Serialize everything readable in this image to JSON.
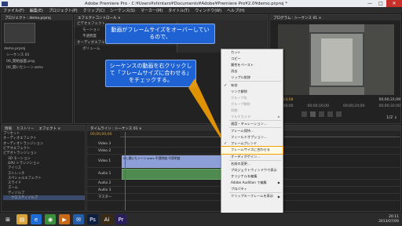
{
  "window": {
    "title": "Adobe Premiere Pro - C:¥Users¥shintaro¥Documents¥Adobe¥Premiere Pro¥2.0¥demo.prproj *",
    "min": "—",
    "max": "□",
    "close": "✕"
  },
  "menu": [
    "ファイル(F)",
    "編集(E)",
    "プロジェクト(P)",
    "クリップ(C)",
    "シーケンス(S)",
    "マーカー(M)",
    "タイトル(T)",
    "ウィンドウ(W)",
    "ヘルプ(H)"
  ],
  "project_panel": {
    "tab": "プロジェクト : demo.prproj",
    "file": "demo.prproj",
    "items": [
      "シーケンス 01",
      "00_開始画面.png",
      "00_開いたシーン.wmv"
    ]
  },
  "effect_controls": {
    "tab": "エフェクトコントロール ×",
    "rows": [
      "ビデオエフェクト",
      "モーション",
      "不透明度",
      "オーディオエフェクト",
      "ボリューム"
    ]
  },
  "program_monitor": {
    "tab": "プログラム : シーケンス 01 ×",
    "time_left": "00;00;14;08",
    "time_right": "00;00;31;09",
    "timecode": "00;00;00;00",
    "ruler": [
      "00;00;16;00",
      "00;00;24;00",
      "00;00;32;00"
    ],
    "status": "1/2 ↓"
  },
  "effects_panel": {
    "tabs": [
      "情報",
      "ヒストリー",
      "エフェクト ×"
    ],
    "items": [
      "プリセット",
      "オーディオエフェクト",
      "オーディオトランジション",
      "ビデオエフェクト",
      "ビデオトランジション",
      "3D モーション",
      "GPU トランジション",
      "アイリス",
      "ストレッチ",
      "スペシャルエフェクト",
      "スライド",
      "ズーム",
      "ディゾルブ",
      "クロスディゾルブ"
    ]
  },
  "timeline": {
    "tab": "タイムライン : シーケンス 01 ×",
    "timecode": "00;00;00;00",
    "tracks": [
      "Video 3",
      "Video 2",
      "Video 1",
      "Audio 1",
      "Audio 2",
      "Audio 3",
      "マスター"
    ],
    "clip_label": "00_開いたシーン.wmv 不透明度:不透明度"
  },
  "callouts": {
    "top": "動画がフレームサイズをオーバーしているので、",
    "bottom": "シーケンスの動画を右クリックして「フレームサイズに合わせる」をチェックする。"
  },
  "context_menu": {
    "items": [
      {
        "label": "カット",
        "enabled": true
      },
      {
        "label": "コピー",
        "enabled": true
      },
      {
        "label": "属性をペースト",
        "enabled": true
      },
      {
        "label": "消去",
        "enabled": true
      },
      {
        "label": "リップル削除",
        "enabled": true
      },
      {
        "sep": true
      },
      {
        "label": "有効",
        "enabled": true,
        "checked": true
      },
      {
        "label": "リンク解除",
        "enabled": true
      },
      {
        "label": "グループ化",
        "enabled": false
      },
      {
        "label": "グループ解除",
        "enabled": false
      },
      {
        "label": "同期",
        "enabled": false
      },
      {
        "label": "マルチカメラ",
        "enabled": false,
        "submenu": true
      },
      {
        "sep": true
      },
      {
        "label": "速度・デュレーション...",
        "enabled": true
      },
      {
        "sep": true
      },
      {
        "label": "フレーム保持...",
        "enabled": true
      },
      {
        "label": "フィールドオプション...",
        "enabled": true
      },
      {
        "label": "フレームブレンド",
        "enabled": true,
        "checked": true
      },
      {
        "label": "フレームサイズに合わせる",
        "enabled": true,
        "highlight": true
      },
      {
        "label": "オーディオゲイン...",
        "enabled": true
      },
      {
        "sep": true
      },
      {
        "label": "名前の変更...",
        "enabled": true
      },
      {
        "label": "プロジェクトウィンドウで表示",
        "enabled": true
      },
      {
        "label": "オリジナルを編集",
        "enabled": true
      },
      {
        "label": "Adobe Audition で編集",
        "enabled": true,
        "submenu": true
      },
      {
        "label": "プロパティ",
        "enabled": true
      },
      {
        "sep": true
      },
      {
        "label": "クリップキーフレームを表示",
        "enabled": true,
        "submenu": true
      }
    ]
  },
  "taskbar": {
    "time": "20:11",
    "date": "2013/07/09"
  },
  "colors": {
    "callout": "#1e62d4",
    "highlight": "#f4a000",
    "video_clip": "#7a8ec9",
    "audio_clip": "#4f8a51"
  }
}
